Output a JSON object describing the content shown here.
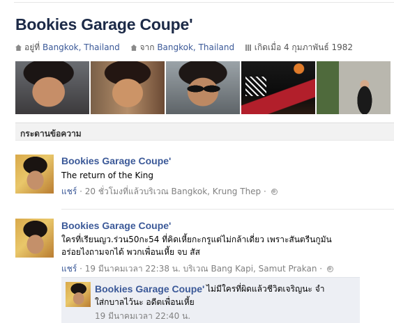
{
  "profile": {
    "name": "Bookies Garage Coupe'",
    "lives_label": "อยู่ที่",
    "lives_place": "Bangkok, Thailand",
    "from_label": "จาก",
    "from_place": "Bangkok, Thailand",
    "born": "เกิดเมื่อ 4 กุมภาพันธ์ 1982"
  },
  "photos": [
    "photo-1",
    "photo-2",
    "photo-3",
    "photo-4",
    "photo-5"
  ],
  "wall": {
    "heading": "กระดานข้อความ"
  },
  "posts": [
    {
      "author": "Bookies Garage Coupe'",
      "lines": [
        "The return of the King"
      ],
      "share": "แชร์",
      "meta": " · 20 ชั่วโมงที่แล้วบริเวณ Bangkok, Krung Thep · "
    },
    {
      "author": "Bookies Garage Coupe'",
      "lines": [
        "ใครที่เรียนญว.ร่วน50กะ54 ที่คิดเหี้ยกะกรูแต่ไม่กล้าเดี่ยว เพราะสันตรีนกูมัน",
        "อร่อยไงถามจกได้ พวกเพื่อนเหี้ย จบ สัส"
      ],
      "share": "แชร์",
      "meta": " · 19 มีนาคมเวลา 22:38 น. บริเวณ Bang Kapi, Samut Prakan · "
    }
  ],
  "reply": {
    "author": "Bookies Garage Coupe'",
    "text_line1": " ไม่มีใครที่ผิดแล้วชีวิตเจริญนะ จำ",
    "text_line2": "ใส่กบาลไว้นะ อดีตเพื่อนเหี้ย",
    "time": "19 มีนาคมเวลา 22:40 น."
  }
}
